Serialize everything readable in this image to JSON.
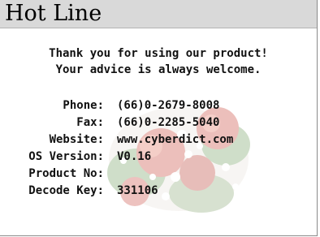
{
  "dialog": {
    "title": "Hot Line",
    "message_line1": "Thank you for using our product!",
    "message_line2": "Your advice is always welcome."
  },
  "info": [
    {
      "label": "Phone:",
      "value": "(66)0-2679-8008"
    },
    {
      "label": "Fax:",
      "value": "(66)0-2285-5040"
    },
    {
      "label": "Website:",
      "value": "www.cyberdict.com"
    },
    {
      "label": "OS Version:",
      "value": "V0.16"
    },
    {
      "label": "Product No:",
      "value": ""
    },
    {
      "label": "Decode Key:",
      "value": "331106"
    }
  ],
  "colors": {
    "title_bar": "#d9d9d9",
    "background": "#ffffff",
    "text": "#111111",
    "watermark_red": "#c0392b",
    "watermark_green": "#5a8a4a"
  }
}
